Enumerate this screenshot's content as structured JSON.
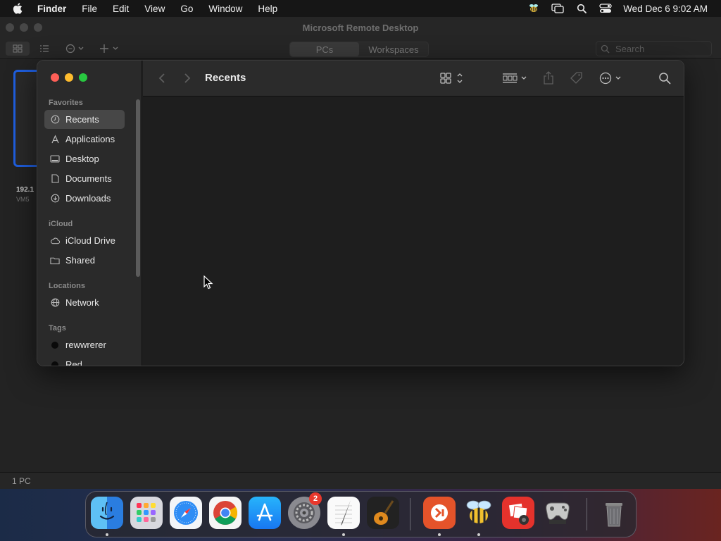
{
  "menubar": {
    "app_name": "Finder",
    "items": [
      "File",
      "Edit",
      "View",
      "Go",
      "Window",
      "Help"
    ],
    "clock": "Wed Dec 6  9:02 AM",
    "status_icons": [
      "bee-menu-icon",
      "screen-mirroring-icon",
      "spotlight-search-icon",
      "control-center-icon"
    ]
  },
  "rd_window": {
    "title": "Microsoft Remote Desktop",
    "tabs": [
      "PCs",
      "Workspaces"
    ],
    "active_tab": "PCs",
    "search_placeholder": "Search",
    "pc": {
      "name": "192.1",
      "subtitle": "VM5"
    },
    "status": "1 PC"
  },
  "finder": {
    "title": "Recents",
    "sidebar": {
      "favorites_header": "Favorites",
      "favorites": [
        {
          "label": "Recents",
          "icon": "clock-icon",
          "selected": true
        },
        {
          "label": "Applications",
          "icon": "applications-icon"
        },
        {
          "label": "Desktop",
          "icon": "desktop-icon"
        },
        {
          "label": "Documents",
          "icon": "document-icon"
        },
        {
          "label": "Downloads",
          "icon": "download-icon"
        }
      ],
      "icloud_header": "iCloud",
      "icloud": [
        {
          "label": "iCloud Drive",
          "icon": "cloud-icon"
        },
        {
          "label": "Shared",
          "icon": "shared-folder-icon"
        }
      ],
      "locations_header": "Locations",
      "locations": [
        {
          "label": "Network",
          "icon": "globe-icon"
        }
      ],
      "tags_header": "Tags",
      "tags": [
        {
          "label": "rewwrerer",
          "color": "#f0f0f0"
        },
        {
          "label": "Red",
          "color": "#f0f0f0"
        }
      ]
    }
  },
  "dock": {
    "apps": [
      {
        "name": "Finder",
        "icon": "finder-icon",
        "running": true
      },
      {
        "name": "Launchpad",
        "icon": "launchpad-icon"
      },
      {
        "name": "Safari",
        "icon": "safari-icon"
      },
      {
        "name": "Chrome",
        "icon": "chrome-icon"
      },
      {
        "name": "App Store",
        "icon": "app-store-icon"
      },
      {
        "name": "System Settings",
        "icon": "system-settings-icon",
        "badge": "2"
      },
      {
        "name": "TextEdit",
        "icon": "textedit-icon",
        "running": true
      },
      {
        "name": "GarageBand",
        "icon": "garageband-icon"
      },
      {
        "name": "Microsoft Remote Desktop",
        "icon": "remote-desktop-icon",
        "running": true
      },
      {
        "name": "Bee",
        "icon": "bee-app-icon",
        "running": true
      },
      {
        "name": "Photo Booth",
        "icon": "photo-booth-icon"
      },
      {
        "name": "Game Controller",
        "icon": "game-controller-icon"
      },
      {
        "name": "Trash",
        "icon": "trash-icon"
      }
    ]
  }
}
